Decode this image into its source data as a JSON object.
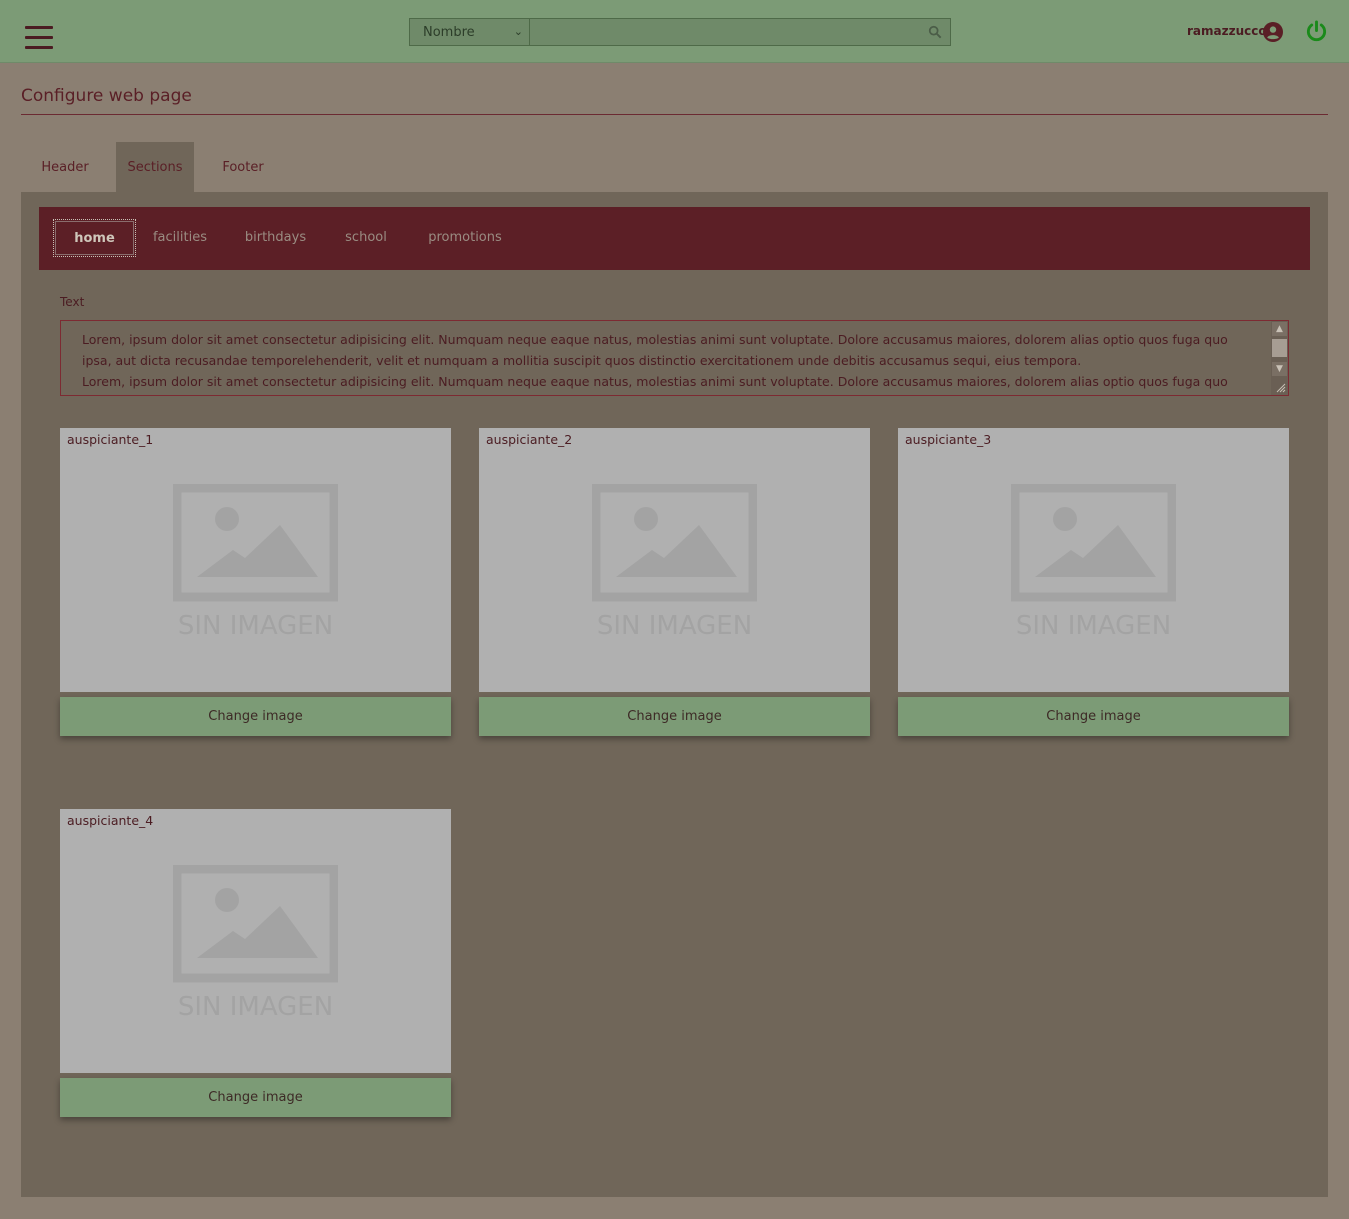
{
  "topbar": {
    "search_select_value": "Nombre",
    "search_input_value": "",
    "username": "ramazzucco"
  },
  "page": {
    "title": "Configure web page"
  },
  "tabs": [
    {
      "label": "Header",
      "active": false
    },
    {
      "label": "Sections",
      "active": true
    },
    {
      "label": "Footer",
      "active": false
    }
  ],
  "sections": [
    {
      "label": "home",
      "active": true
    },
    {
      "label": "facilities",
      "active": false
    },
    {
      "label": "birthdays",
      "active": false
    },
    {
      "label": "school",
      "active": false
    },
    {
      "label": "promotions",
      "active": false
    }
  ],
  "text_field": {
    "label": "Text",
    "value": "Lorem, ipsum dolor sit amet consectetur adipisicing elit. Numquam neque eaque natus, molestias animi sunt voluptate. Dolore accusamus maiores, dolorem alias optio quos fuga quo ipsa, aut dicta recusandae temporelehenderit, velit et numquam a mollitia suscipit quos distinctio exercitationem unde debitis accusamus sequi, eius tempora.\nLorem, ipsum dolor sit amet consectetur adipisicing elit. Numquam neque eaque natus, molestias animi sunt voluptate. Dolore accusamus maiores, dolorem alias optio quos fuga quo ipsa, aut"
  },
  "sponsors": [
    {
      "caption": "auspiciante_1",
      "placeholder_text": "SIN IMAGEN",
      "button": "Change image"
    },
    {
      "caption": "auspiciante_2",
      "placeholder_text": "SIN IMAGEN",
      "button": "Change image"
    },
    {
      "caption": "auspiciante_3",
      "placeholder_text": "SIN IMAGEN",
      "button": "Change image"
    },
    {
      "caption": "auspiciante_4",
      "placeholder_text": "SIN IMAGEN",
      "button": "Change image"
    }
  ],
  "colors": {
    "topbar": "#7c9b76",
    "background": "#8b7f72",
    "panel": "#706659",
    "section_bar": "#5c1f26",
    "power_icon": "#1a8a1a"
  },
  "icons": {
    "menu": "hamburger-menu-icon",
    "search": "search-icon",
    "user": "user-circle-icon",
    "power": "power-icon",
    "placeholder": "image-placeholder-icon"
  }
}
